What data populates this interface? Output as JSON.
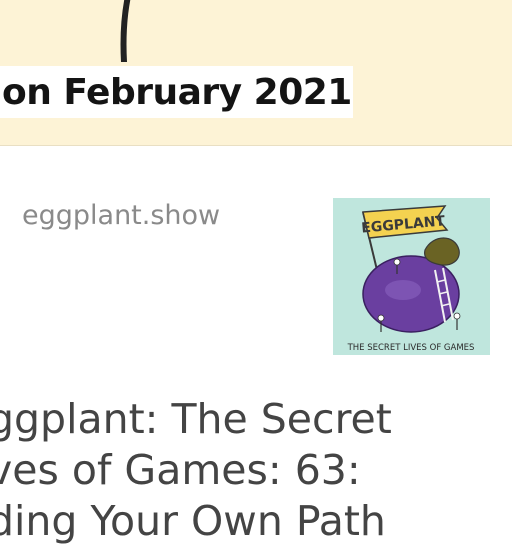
{
  "banner": {
    "title": "on February 2021"
  },
  "link_card": {
    "domain": "eggplant.show",
    "thumbnail": {
      "title": "EGGPLANT",
      "tagline": "THE SECRET LIVES OF GAMES"
    },
    "headline_lines": [
      "ggplant: The Secret",
      "ves of Games: 63:",
      "ding Your Own Path"
    ]
  },
  "colors": {
    "banner_bg": "#fdf3d6",
    "thumb_bg": "#bfe6dd",
    "eggplant": "#6a3fa0",
    "flag": "#f4d250",
    "domain_text": "#8a8a8a",
    "headline_text": "#444444"
  }
}
